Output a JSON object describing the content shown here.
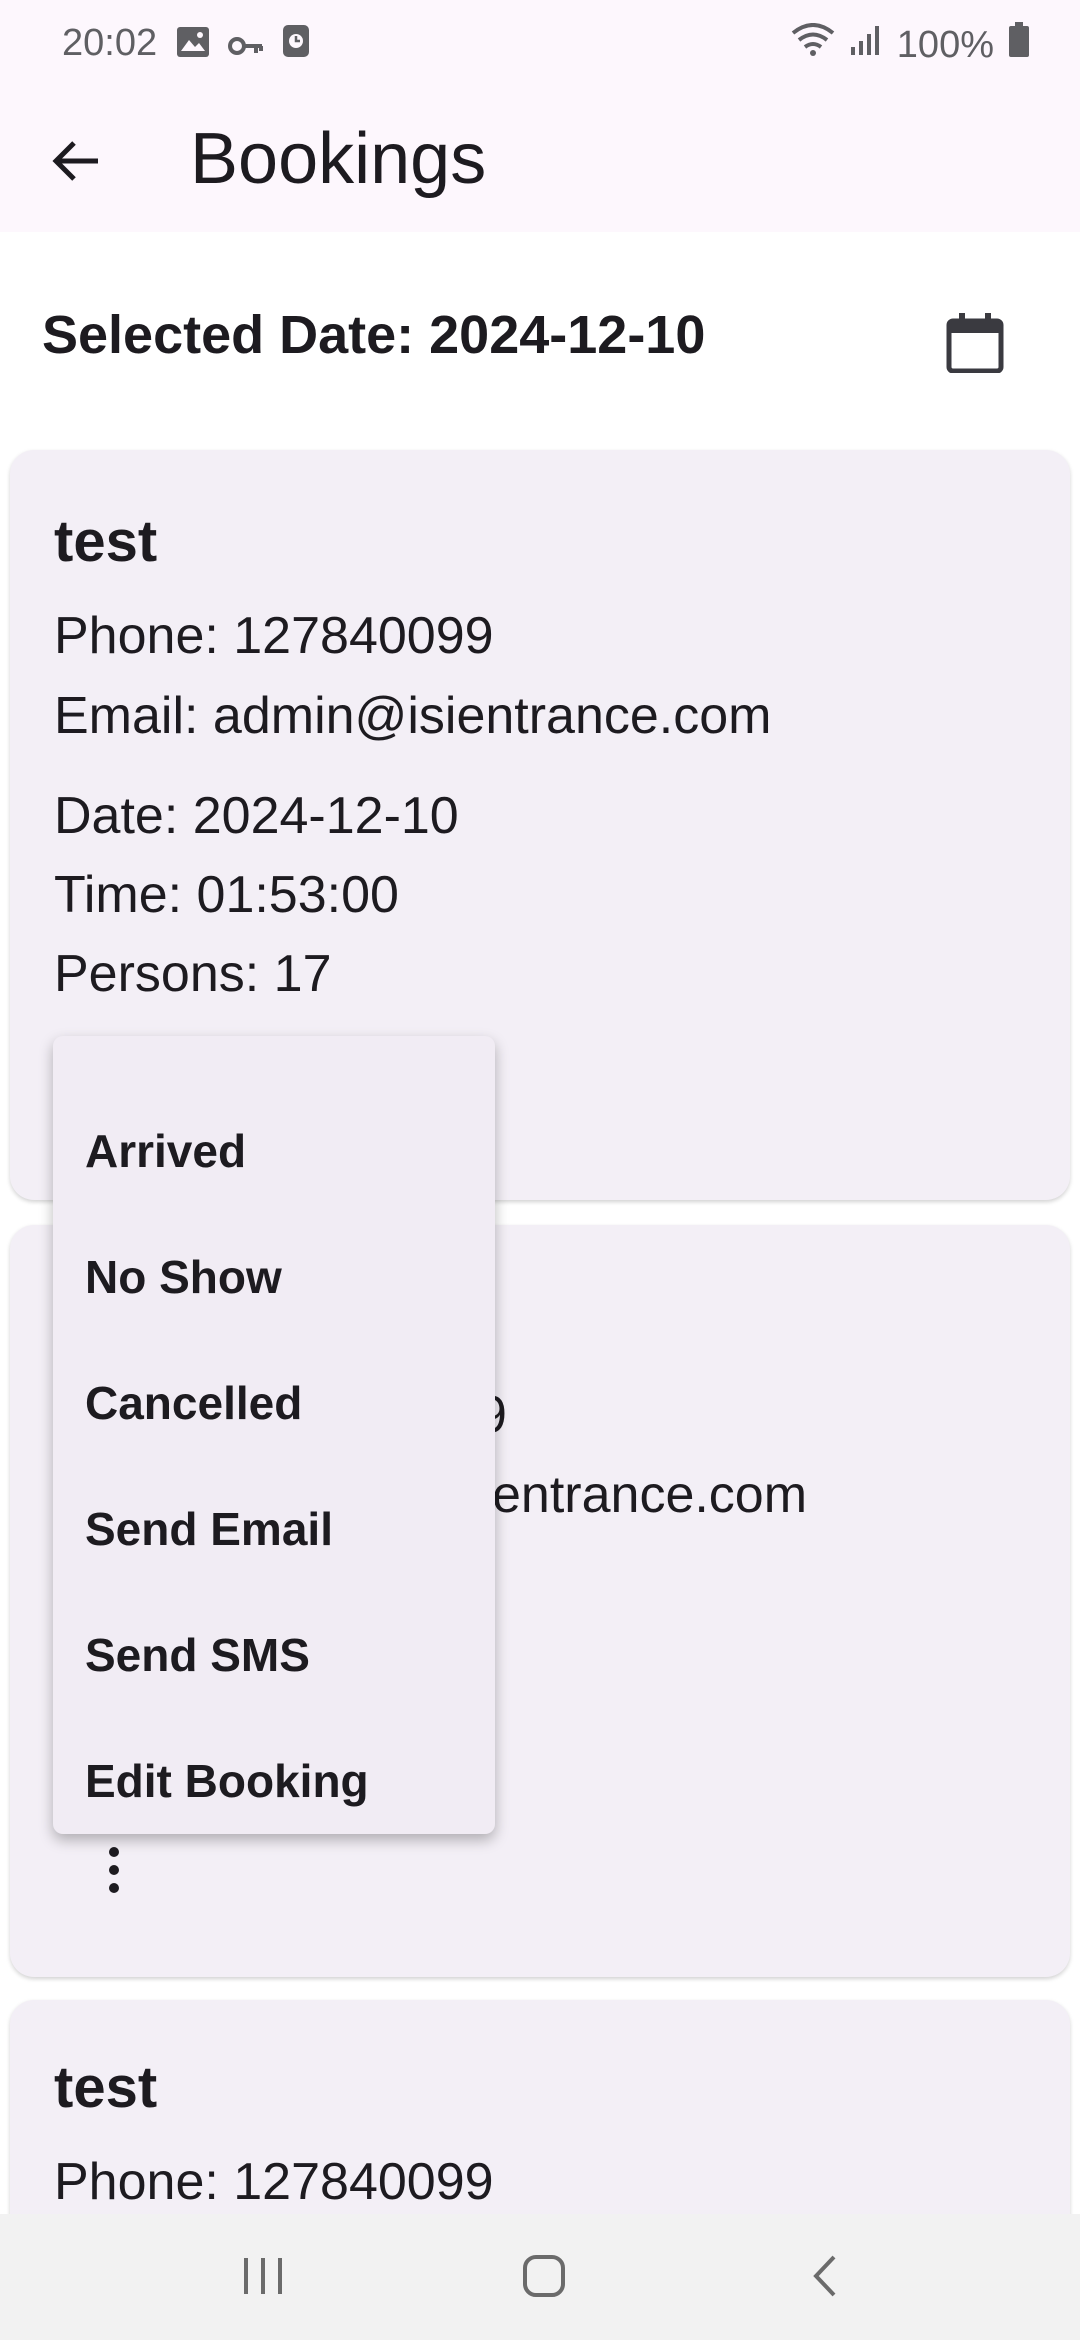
{
  "status_bar": {
    "time": "20:02",
    "battery": "100%"
  },
  "app_bar": {
    "title": "Bookings"
  },
  "date_selector": {
    "label": "Selected Date: 2024-12-10"
  },
  "bookings": [
    {
      "name": "test",
      "phone": "Phone: 127840099",
      "email": "Email: admin@isientrance.com",
      "date": "Date: 2024-12-10",
      "time": "Time: 01:53:00",
      "persons": "Persons: 17"
    },
    {
      "phone_partial": "9",
      "email_partial": "entrance.com"
    },
    {
      "name": "test",
      "phone": "Phone: 127840099"
    }
  ],
  "menu": {
    "items": [
      "Arrived",
      "No Show",
      "Cancelled",
      "Send Email",
      "Send SMS",
      "Edit Booking"
    ]
  },
  "colors": {
    "app_bar_bg": "#fdf7fd",
    "card_bg": "#f3eff6",
    "menu_bg": "#f1ecf4",
    "text": "#1d1b20",
    "nav_bar_bg": "#f2f2f2"
  },
  "icons": {
    "back": "arrow-left",
    "calendar": "calendar",
    "more": "more-vertical"
  }
}
